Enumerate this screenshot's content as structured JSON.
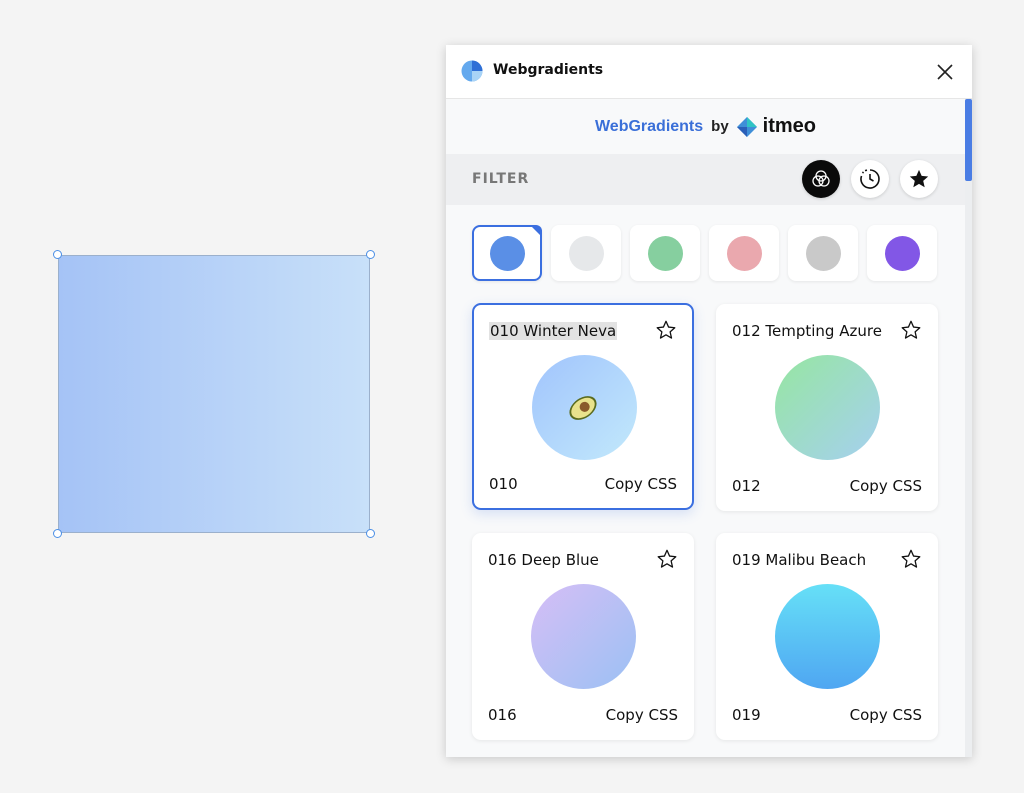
{
  "window": {
    "title": "Webgradients"
  },
  "brand": {
    "name": "WebGradients",
    "by": "by",
    "company": "itmeo"
  },
  "filter": {
    "label": "FILTER",
    "buttons": [
      {
        "icon": "color-filter-icon",
        "active": true
      },
      {
        "icon": "history-icon",
        "active": false
      },
      {
        "icon": "star-filled-icon",
        "active": false
      }
    ]
  },
  "color_filters": [
    {
      "color": "#5a8fe6",
      "selected": true
    },
    {
      "color": "#e6e8ea",
      "selected": false
    },
    {
      "color": "#86cf9f",
      "selected": false
    },
    {
      "color": "#eaa8ae",
      "selected": false
    },
    {
      "color": "#c9c9c9",
      "selected": false
    },
    {
      "color": "#8257e6",
      "selected": false
    }
  ],
  "gradients": [
    {
      "name": "010 Winter Neva",
      "id": "010",
      "copy": "Copy CSS",
      "colors": [
        "#a1c4fd",
        "#c2e9fb"
      ],
      "selected": true
    },
    {
      "name": "012 Tempting Azure",
      "id": "012",
      "copy": "Copy CSS",
      "colors": [
        "#96e6a1",
        "#a6d0f0"
      ],
      "selected": false
    },
    {
      "name": "016 Deep Blue",
      "id": "016",
      "copy": "Copy CSS",
      "colors": [
        "#d6bef6",
        "#9bc1f3"
      ],
      "selected": false
    },
    {
      "name": "019 Malibu Beach",
      "id": "019",
      "copy": "Copy CSS",
      "colors": [
        "#66e0f7",
        "#4fa6f2"
      ],
      "selected": false
    }
  ]
}
